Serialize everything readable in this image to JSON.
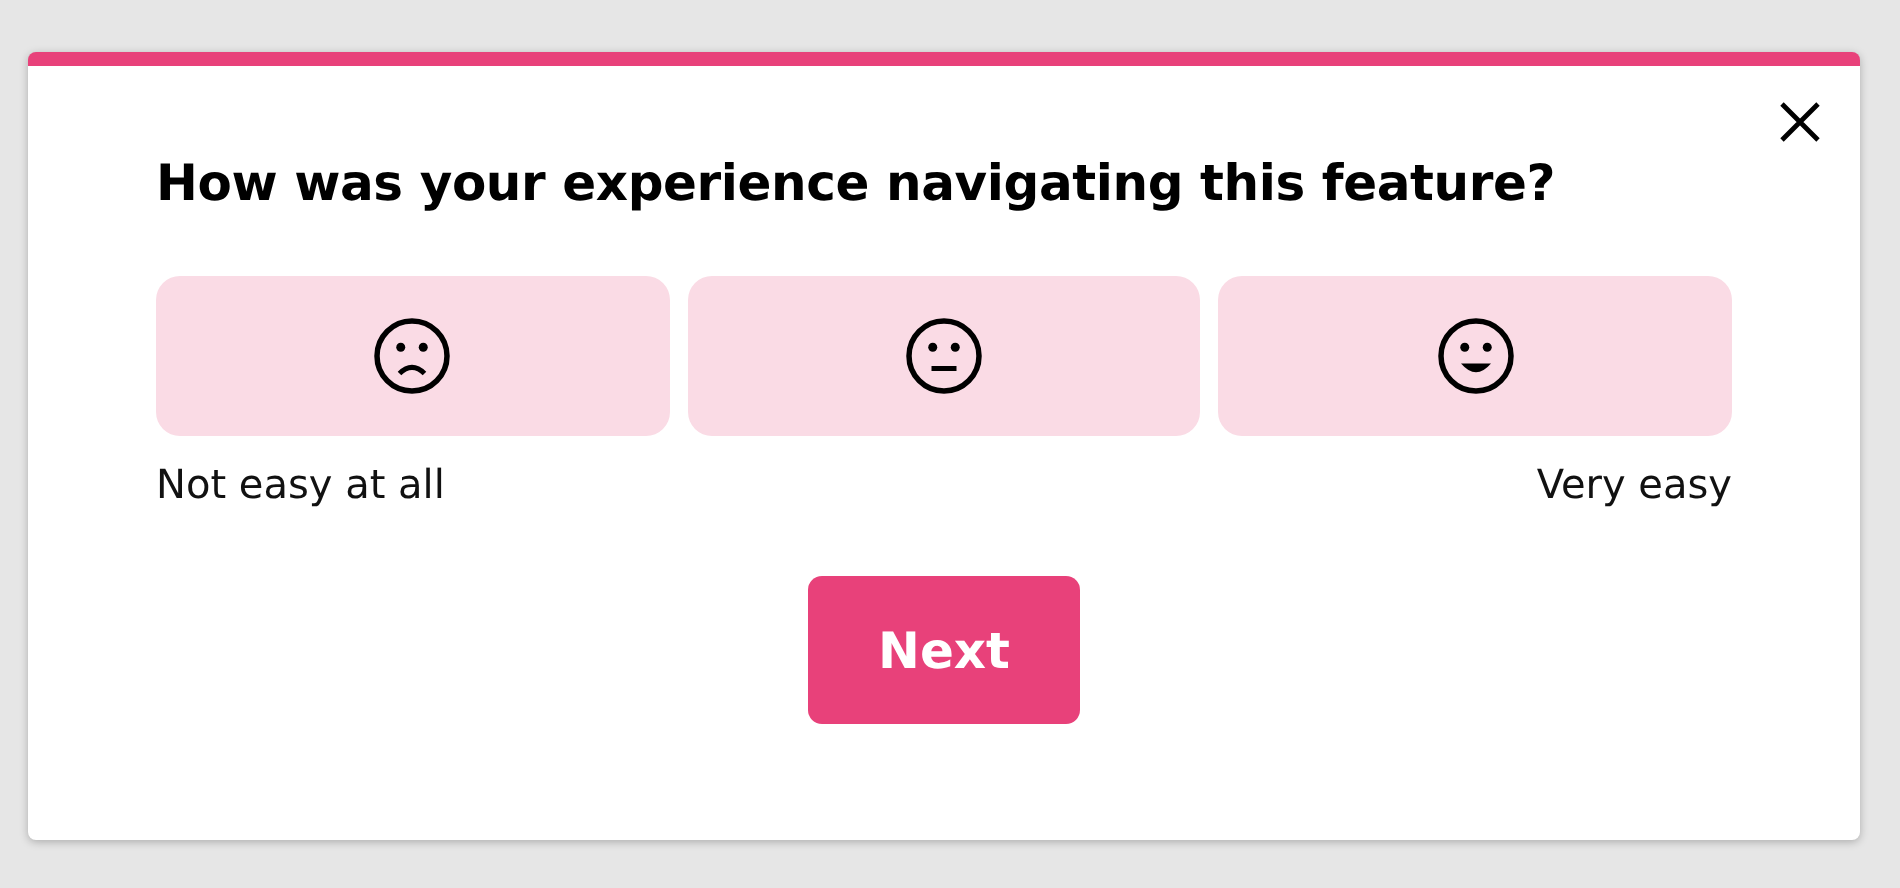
{
  "dialog": {
    "question": "How was your experience navigating this feature?",
    "options": [
      {
        "kind": "sad"
      },
      {
        "kind": "neutral"
      },
      {
        "kind": "happy"
      }
    ],
    "scale_labels": {
      "low": "Not easy at all",
      "high": "Very easy"
    },
    "button": "Next"
  }
}
